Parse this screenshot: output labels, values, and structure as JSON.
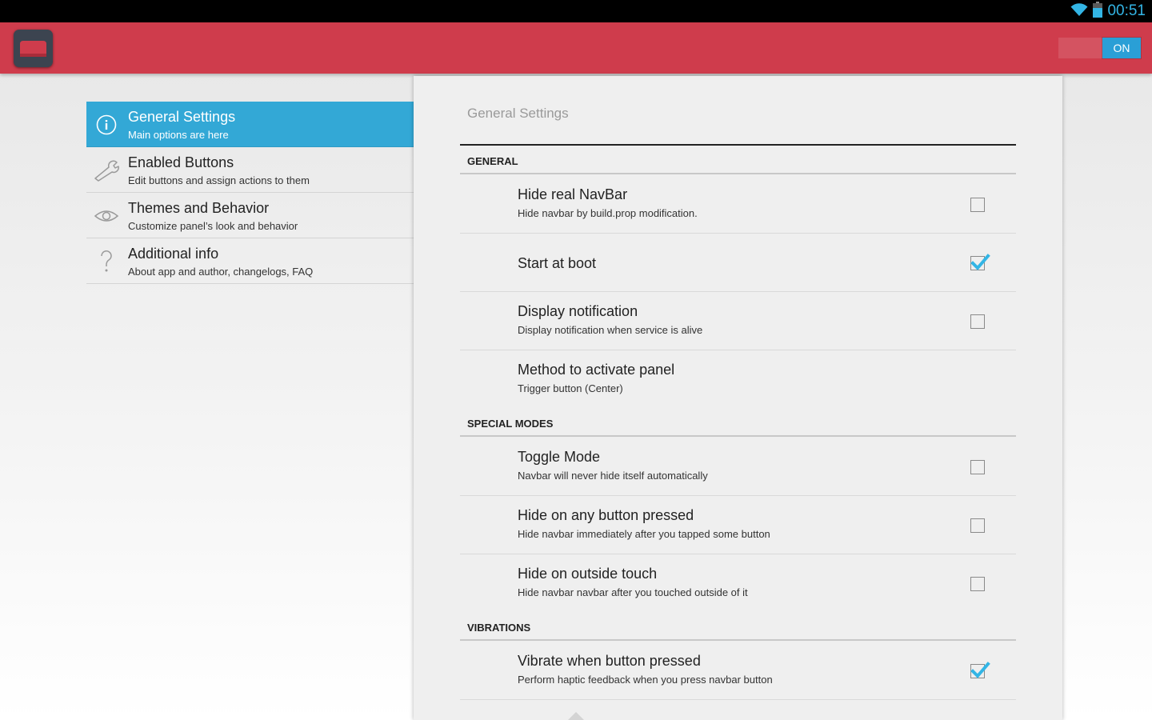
{
  "status_bar": {
    "time": "00:51",
    "icons": [
      "wifi-icon",
      "battery-icon"
    ],
    "clock_color": "#33b5e5"
  },
  "action_bar": {
    "color": "#cf3c4c",
    "app_icon": "app-icon",
    "switch_label": "ON",
    "switch_color": "#2a9fd6"
  },
  "menu": {
    "active_color": "#33a8d6",
    "items": [
      {
        "title": "General Settings",
        "subtitle": "Main options are here",
        "icon": "info-icon",
        "active": true
      },
      {
        "title": "Enabled Buttons",
        "subtitle": "Edit buttons and assign actions to them",
        "icon": "wrench-icon",
        "active": false
      },
      {
        "title": "Themes and Behavior",
        "subtitle": "Customize panel’s look and behavior",
        "icon": "eye-icon",
        "active": false
      },
      {
        "title": "Additional info",
        "subtitle": "About app and author, changelogs, FAQ",
        "icon": "question-icon",
        "active": false
      }
    ]
  },
  "panel": {
    "title": "General Settings",
    "categories": {
      "general": "GENERAL",
      "special": "SPECIAL MODES",
      "vibrations": "VIBRATIONS"
    },
    "prefs": [
      {
        "title": "Hide real NavBar",
        "subtitle": "Hide navbar by build.prop modification.",
        "checked": false
      },
      {
        "title": "Start at boot",
        "subtitle": "",
        "checked": true
      },
      {
        "title": "Display notification",
        "subtitle": "Display notification when service is alive",
        "checked": false
      },
      {
        "title": "Method to activate panel",
        "subtitle": "Trigger button (Center)"
      },
      {
        "title": "Toggle Mode",
        "subtitle": "Navbar will never hide itself automatically",
        "checked": false
      },
      {
        "title": "Hide on any button pressed",
        "subtitle": "Hide navbar immediately after you tapped some button",
        "checked": false
      },
      {
        "title": "Hide on outside touch",
        "subtitle": "Hide navbar navbar after you touched outside of it",
        "checked": false
      },
      {
        "title": "Vibrate when button pressed",
        "subtitle": "Perform haptic feedback when you press navbar button",
        "checked": true
      }
    ],
    "check_color": "#33b5e5"
  }
}
